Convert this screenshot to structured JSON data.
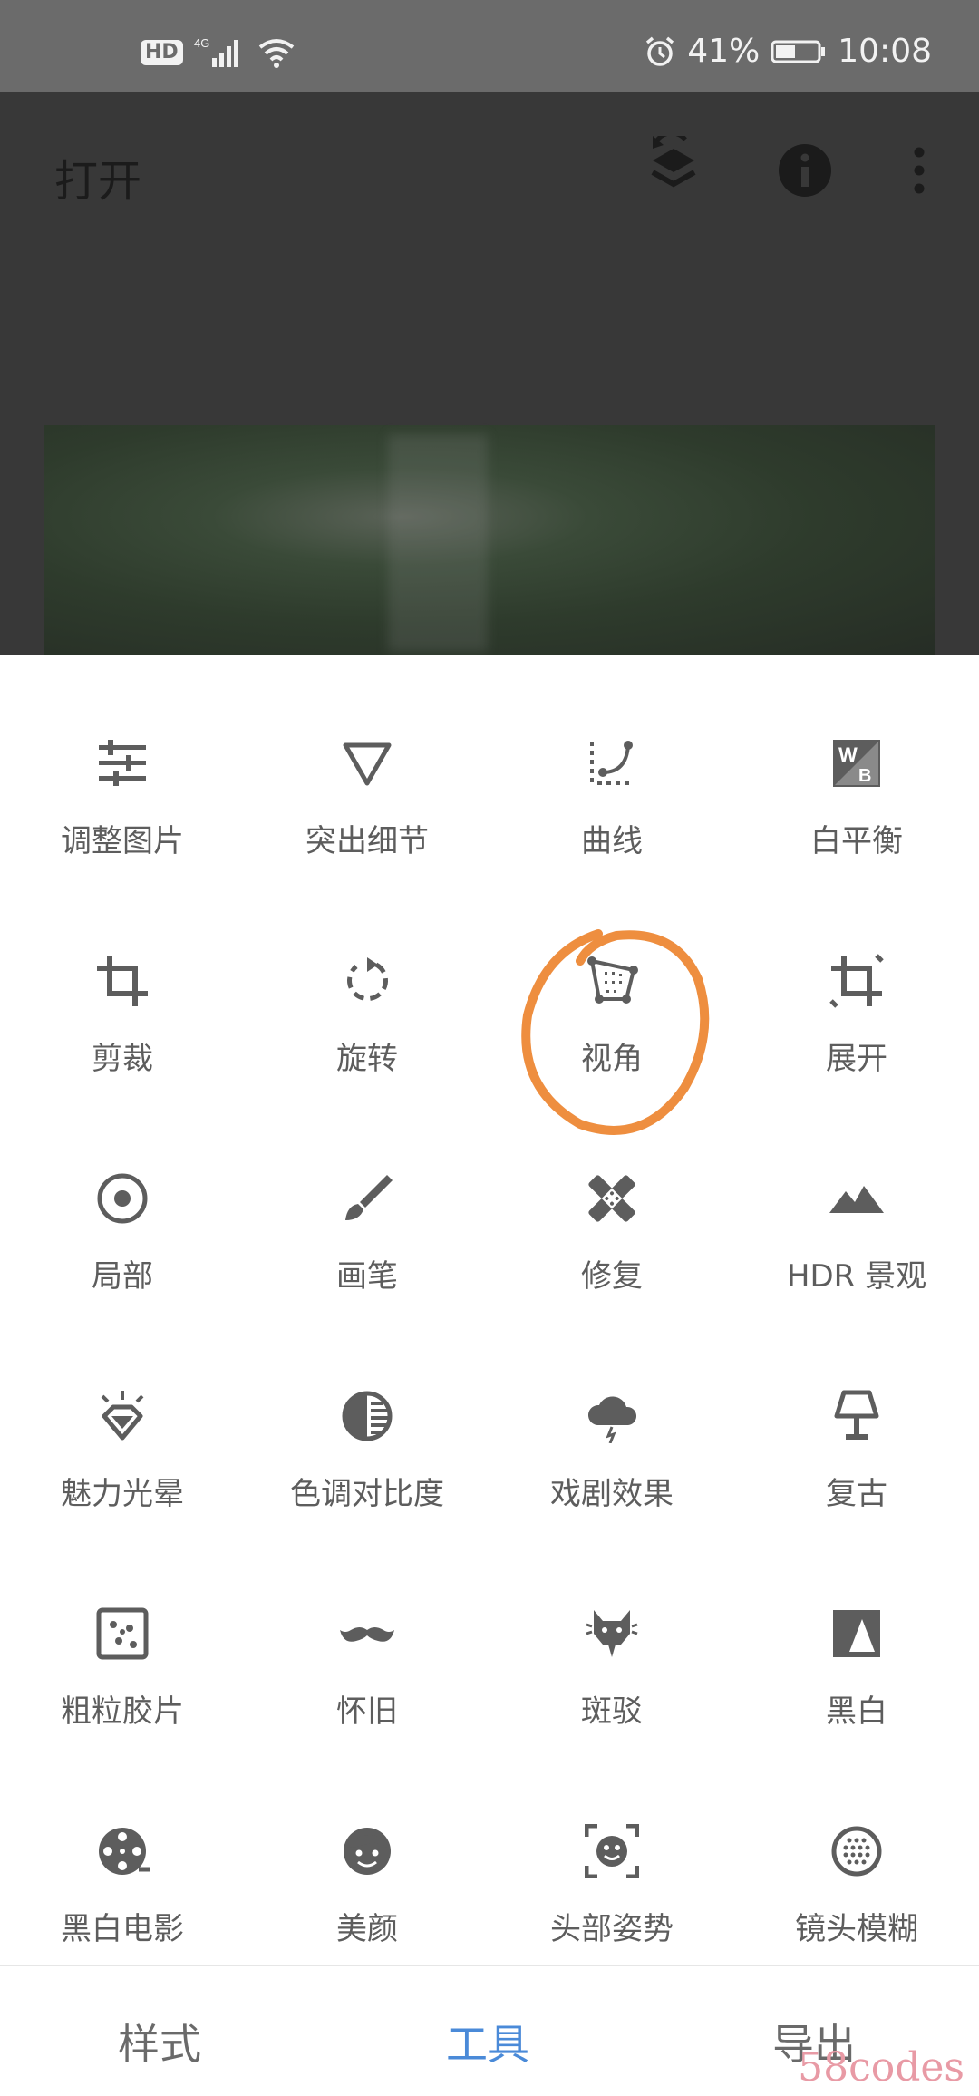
{
  "status": {
    "network": "4G",
    "battery": "41%",
    "time": "10:08"
  },
  "header": {
    "title": "打开"
  },
  "tools": [
    {
      "label": "调整图片",
      "icon": "tune-icon"
    },
    {
      "label": "突出细节",
      "icon": "details-triangle-icon"
    },
    {
      "label": "曲线",
      "icon": "curves-icon"
    },
    {
      "label": "白平衡",
      "icon": "white-balance-icon"
    },
    {
      "label": "剪裁",
      "icon": "crop-icon"
    },
    {
      "label": "旋转",
      "icon": "rotate-icon"
    },
    {
      "label": "视角",
      "icon": "perspective-icon"
    },
    {
      "label": "展开",
      "icon": "expand-icon"
    },
    {
      "label": "局部",
      "icon": "selective-icon"
    },
    {
      "label": "画笔",
      "icon": "brush-icon"
    },
    {
      "label": "修复",
      "icon": "healing-icon"
    },
    {
      "label": "HDR 景观",
      "icon": "hdr-mountain-icon"
    },
    {
      "label": "魅力光晕",
      "icon": "glamour-glow-icon"
    },
    {
      "label": "色调对比度",
      "icon": "tonal-contrast-icon"
    },
    {
      "label": "戏剧效果",
      "icon": "drama-cloud-icon"
    },
    {
      "label": "复古",
      "icon": "vintage-lamp-icon"
    },
    {
      "label": "粗粒胶片",
      "icon": "grainy-film-icon"
    },
    {
      "label": "怀旧",
      "icon": "retrolux-mustache-icon"
    },
    {
      "label": "斑驳",
      "icon": "grunge-icon"
    },
    {
      "label": "黑白",
      "icon": "black-white-icon"
    },
    {
      "label": "黑白电影",
      "icon": "noir-film-reel-icon"
    },
    {
      "label": "美颜",
      "icon": "face-icon"
    },
    {
      "label": "头部姿势",
      "icon": "head-pose-icon"
    },
    {
      "label": "镜头模糊",
      "icon": "lens-blur-icon"
    }
  ],
  "bottom_nav": [
    {
      "label": "样式"
    },
    {
      "label": "工具"
    },
    {
      "label": "导出"
    }
  ],
  "watermark": "58codes",
  "colors": {
    "accent": "#4a8ad8",
    "annotation": "#ee8e3f",
    "icon": "#5d5d5d"
  }
}
